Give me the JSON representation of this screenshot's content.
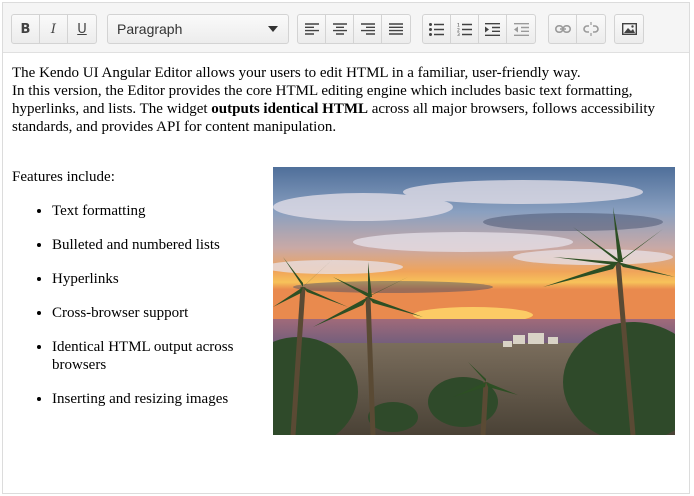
{
  "toolbar": {
    "bold_label": "B",
    "italic_label": "I",
    "underline_label": "U",
    "format_select": {
      "selected": "Paragraph"
    },
    "icons": [
      "bold",
      "italic",
      "underline",
      "align-left-icon",
      "align-center-icon",
      "align-right-icon",
      "align-justify-icon",
      "bulleted-list-icon",
      "numbered-list-icon",
      "indent-icon",
      "outdent-icon",
      "link-icon",
      "unlink-icon",
      "insert-image-icon"
    ]
  },
  "content": {
    "intro_line1": "The Kendo UI Angular Editor allows your users to edit HTML in a familiar, user-friendly way.",
    "intro_line2_part1": "In this version, the Editor provides the core HTML editing engine which includes basic text formatting, hyperlinks, and lists. The widget ",
    "intro_bold": "outputs identical HTML",
    "intro_line2_part2": " across all major browsers, follows accessibility standards, and provides API for content manipulation.",
    "features_heading": "Features include:",
    "features": [
      "Text formatting",
      "Bulleted and numbered lists",
      "Hyperlinks",
      "Cross-browser support",
      "Identical HTML output across browsers",
      "Inserting and resizing images"
    ]
  },
  "colors": {
    "toolbar_bg": "#f5f5f5",
    "border": "#d3d3d3",
    "icon": "#424242"
  }
}
